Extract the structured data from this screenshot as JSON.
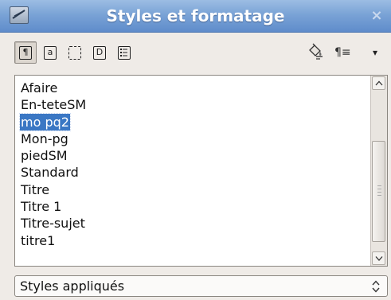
{
  "window": {
    "title": "Styles et formatage",
    "close_glyph": "×"
  },
  "toolbar": {
    "buttons": [
      {
        "name": "paragraph-styles",
        "icon": "pilcrow-icon",
        "glyph": "¶",
        "active": true
      },
      {
        "name": "character-styles",
        "icon": "character-a-icon",
        "glyph": "a",
        "active": false
      },
      {
        "name": "frame-styles",
        "icon": "frame-icon",
        "glyph": "",
        "active": false
      },
      {
        "name": "page-styles",
        "icon": "page-icon",
        "glyph": "D",
        "active": false
      },
      {
        "name": "list-styles",
        "icon": "list-icon",
        "glyph": "",
        "active": false
      }
    ],
    "right_tools": [
      {
        "name": "fill-format-mode",
        "icon": "paint-bucket-icon"
      },
      {
        "name": "new-style-from-selection",
        "icon": "pilcrow-lines-icon",
        "glyph": "¶≡"
      },
      {
        "name": "more-options",
        "icon": "dropdown-arrow-icon",
        "glyph": "▾"
      }
    ]
  },
  "styles_list": {
    "items": [
      "Afaire",
      "En-teteSM",
      "mo pq2",
      "Mon-pg",
      "piedSM",
      "Standard",
      "Titre",
      "Titre 1",
      "Titre-sujet",
      "titre1"
    ],
    "selected_index": 2,
    "scroll_position": 0.85
  },
  "filter": {
    "value": "Styles appliqués"
  },
  "colors": {
    "title_bar": "#7aa3d6",
    "selection": "#3a77c4",
    "background": "#efebe7"
  }
}
